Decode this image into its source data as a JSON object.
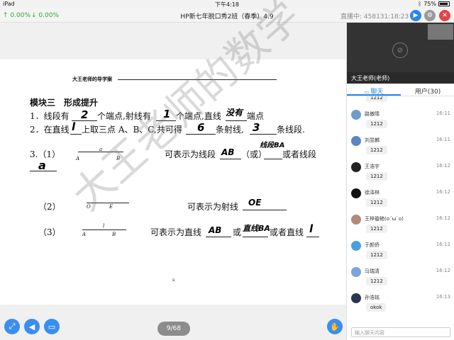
{
  "status_bar": {
    "device": "iPad",
    "time": "下午4:18",
    "battery": "75%",
    "battery_level": 0.75
  },
  "top_bar": {
    "upload": "↑ 0.00%",
    "download": "↓ 0.00%",
    "title": "HP新七年脱口秀2班（春季）4.9",
    "live_label": "直播中: 458131:18:23"
  },
  "document": {
    "header_title": "大王老师的导学案",
    "section_title": "模块三　形成提升",
    "q1_a": "1．线段有",
    "q1_b": "个端点,射线有",
    "q1_c": "个端点,直线",
    "q1_d": "端点",
    "q2_a": "2．在直线",
    "q2_b": "上取三点 A、B、C,共可得",
    "q2_c": "条射线,",
    "q2_d": "条线段.",
    "q3_label": "3.（1）",
    "q3_1_a": "可表示为线段",
    "q3_1_b": "（或）",
    "q3_1_c": "或者线段",
    "q3_2_label": "（2）",
    "q3_2_a": "可表示为射线",
    "q3_3_label": "（3）",
    "q3_3_a": "可表示为直线",
    "q3_3_b": "或",
    "q3_3_c": "或者直线",
    "fig1": {
      "a": "A",
      "b": "B",
      "mid": "a"
    },
    "fig2": {
      "o": "O",
      "e": "E"
    },
    "fig3": {
      "a": "A",
      "b": "B",
      "mid": "l"
    },
    "handwriting": {
      "h1": "2",
      "h2": "1",
      "h3": "没有",
      "h4": "l",
      "h5": "6",
      "h6": "3",
      "h7": "AB",
      "h8": "线段BA",
      "h9": "a",
      "h10": "OE",
      "h11": "AB",
      "h12": "直线BA",
      "h13": "l"
    },
    "watermark": "大王老师的数学",
    "page_indicator": "9/68",
    "dot": "s"
  },
  "right_panel": {
    "teacher_label": "大王老师(老师)",
    "tabs": [
      {
        "label": "聊天"
      },
      {
        "label": "用户(30)"
      }
    ],
    "messages": [
      {
        "name": "",
        "time": "",
        "text": "1212",
        "avatar_color": "#9bb8d6"
      },
      {
        "name": "路傲晴",
        "time": "16:11",
        "text": "1212",
        "avatar_color": "#6d9ccc"
      },
      {
        "name": "刘昱麟",
        "time": "16:11",
        "text": "1212",
        "avatar_color": "#5a86c2"
      },
      {
        "name": "王浩宇",
        "time": "16:12",
        "text": "1212",
        "avatar_color": "#222222"
      },
      {
        "name": "徐泽林",
        "time": "16:12",
        "text": "1212",
        "avatar_color": "#111111"
      },
      {
        "name": "王梓璇艳(o´ω`o)",
        "time": "16:12",
        "text": "1212",
        "avatar_color": "#b08a7a"
      },
      {
        "name": "于颜侨",
        "time": "16:12",
        "text": "1212",
        "avatar_color": "#4aa0d8"
      },
      {
        "name": "马瑞清",
        "time": "16:12",
        "text": "1212",
        "avatar_color": "#78a6d8"
      },
      {
        "name": "孙浩铭",
        "time": "16:13",
        "text": "okok",
        "avatar_color": "#2a3550"
      }
    ],
    "chat_placeholder": "输入聊天内容"
  }
}
